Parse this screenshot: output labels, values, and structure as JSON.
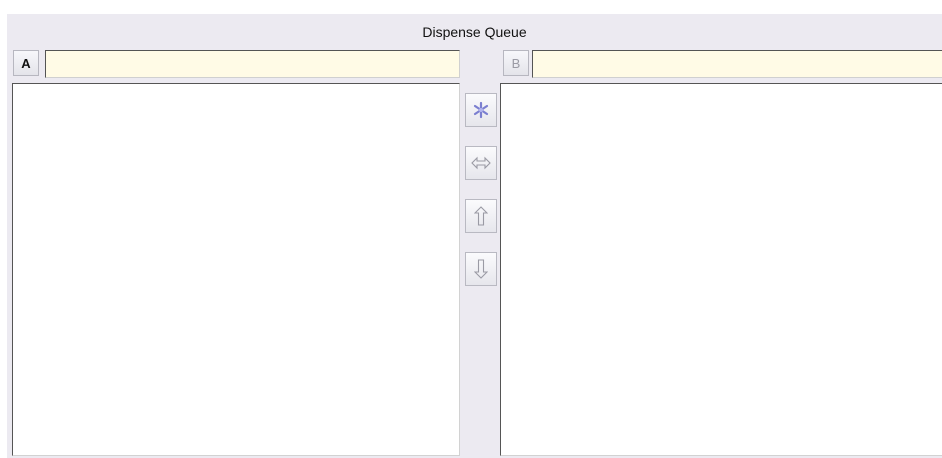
{
  "window": {
    "title": "Dispense Queue"
  },
  "panel_a": {
    "key_label": "A",
    "field_value": "",
    "items": []
  },
  "panel_b": {
    "key_label": "B",
    "field_value": "",
    "items": []
  },
  "toolbar": {
    "buttons": [
      {
        "icon": "star-burst-icon",
        "enabled": true
      },
      {
        "icon": "swap-horizontal-icon",
        "enabled": false
      },
      {
        "icon": "arrow-up-icon",
        "enabled": false
      },
      {
        "icon": "arrow-down-icon",
        "enabled": false
      }
    ]
  },
  "colors": {
    "frame_bg": "#eceaf1",
    "field_bg": "#fffbe6",
    "star_accent": "#7b7fd0",
    "disabled_icon": "#9a9aa4"
  }
}
